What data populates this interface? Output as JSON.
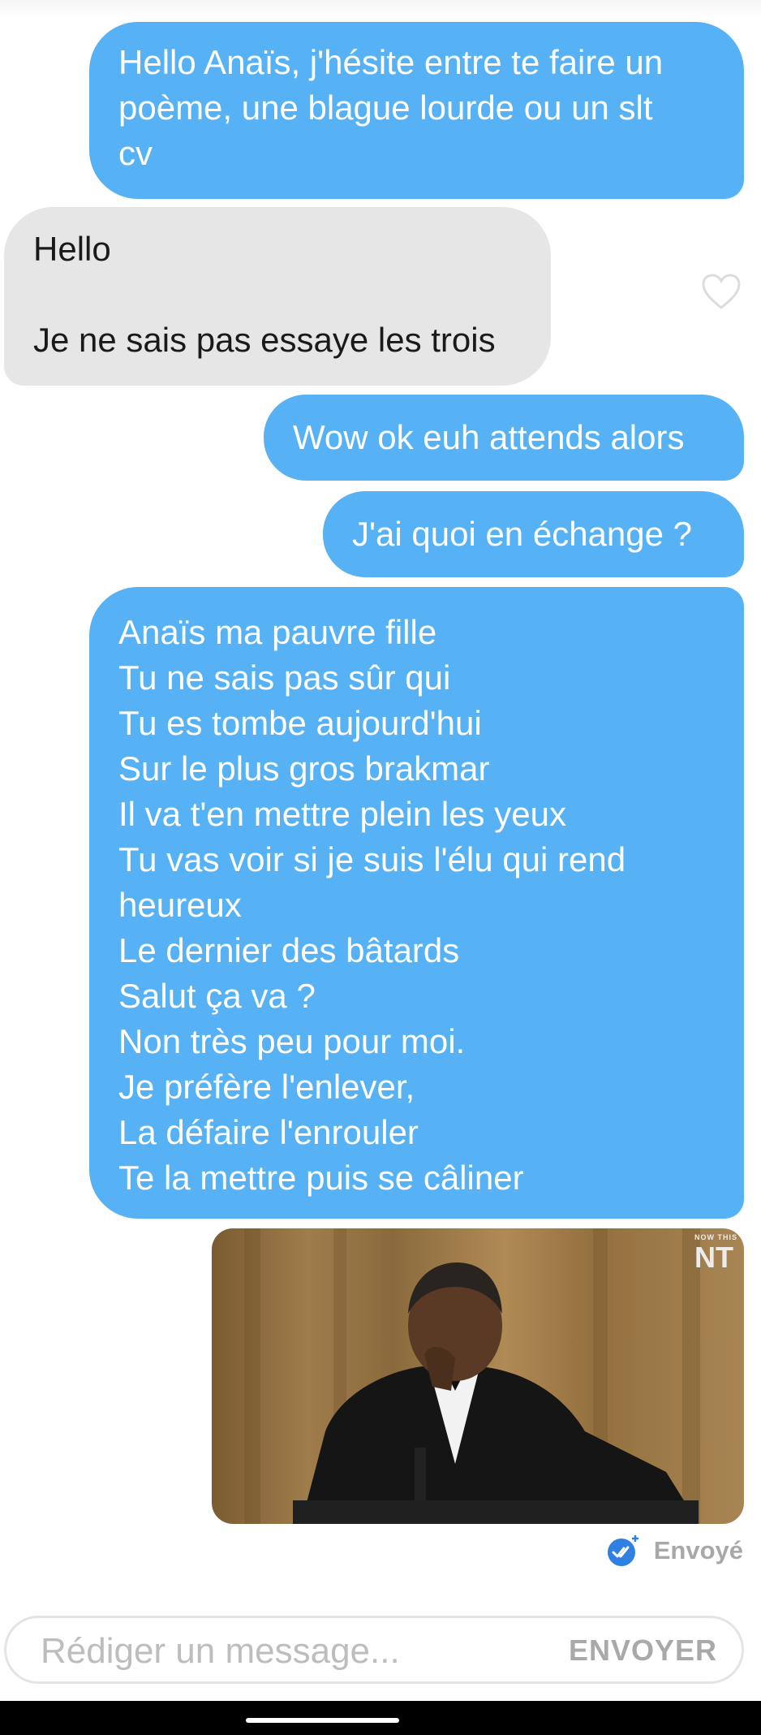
{
  "messages": [
    {
      "id": "m1",
      "from": "me",
      "text": "Hello Anaïs, j'hésite entre te faire un\npoème, une blague lourde ou un slt\ncv"
    },
    {
      "id": "m2",
      "from": "them",
      "text": "Hello\n\nJe ne sais pas essaye les trois"
    },
    {
      "id": "m3",
      "from": "me",
      "text": "Wow ok euh attends alors"
    },
    {
      "id": "m4",
      "from": "me",
      "text": "J'ai quoi en échange ?"
    },
    {
      "id": "m5",
      "from": "me",
      "text": "Anaïs ma pauvre fille\nTu ne sais pas sûr qui\nTu es tombe aujourd'hui\nSur le plus gros brakmar\nIl va t'en mettre plein les yeux\nTu vas voir si je suis l'élu qui rend\nheureux\nLe dernier des bâtards\nSalut ça va ?\nNon très peu pour moi.\nJe préfère l'enlever,\nLa défaire l'enrouler\nTe la mettre puis se câliner"
    }
  ],
  "gif": {
    "logo_small": "NOW THIS",
    "logo_text": "NT"
  },
  "status": {
    "text": "Envoyé",
    "icon": "double-check-icon"
  },
  "composer": {
    "placeholder": "Rédiger un message...",
    "value": "",
    "send_label": "ENVOYER"
  },
  "colors": {
    "sent_bubble": "#56b2f4",
    "received_bubble": "#e6e6e6",
    "status_icon": "#2f80e2"
  }
}
